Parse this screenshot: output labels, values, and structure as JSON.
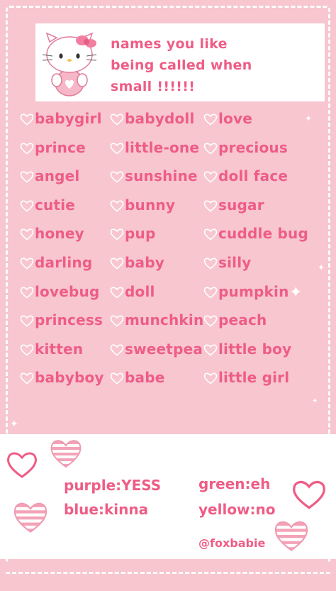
{
  "header": {
    "title_lines": [
      "names you like",
      "being called when",
      "small !!!!!!"
    ],
    "mascot": "hello-kitty-icon"
  },
  "columns": [
    [
      "babygirl",
      "prince",
      "angel",
      "cutie",
      "honey",
      "darling",
      "lovebug",
      "princess",
      "kitten",
      "babyboy"
    ],
    [
      "babydoll",
      "little-one",
      "sunshine",
      "bunny",
      "pup",
      "baby",
      "doll",
      "munchkin",
      "sweetpea",
      "babe"
    ],
    [
      "love",
      "precious",
      "doll face",
      "sugar",
      "cuddle bug",
      "silly",
      "pumpkin",
      "peach",
      "little boy",
      "little girl"
    ]
  ],
  "legend": {
    "purple": "purple:YESS",
    "blue": "blue:kinna",
    "green": "green:eh",
    "yellow": "yellow:no"
  },
  "handle": "@foxbabie",
  "colors": {
    "background": "#f7c6cf",
    "text": "#ee5d86",
    "panel": "#ffffff"
  },
  "icons": [
    "heart-outline-icon",
    "striped-heart-icon",
    "sparkle-icon"
  ]
}
